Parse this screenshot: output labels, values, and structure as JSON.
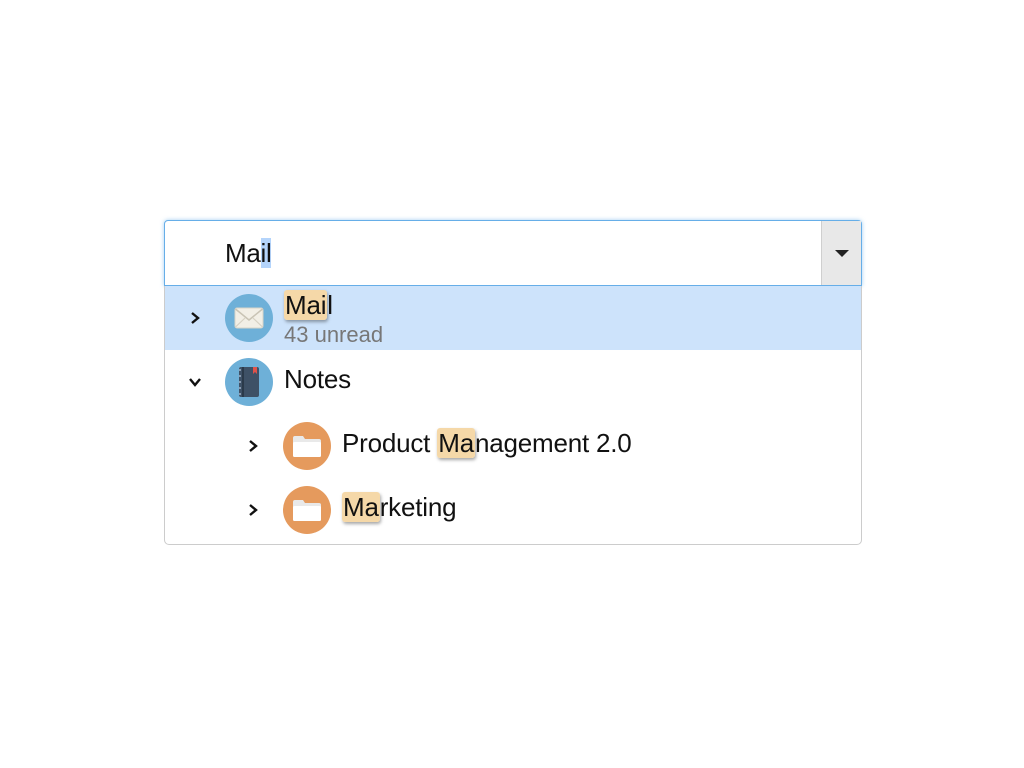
{
  "combobox": {
    "input_value_prefix": "Ma",
    "input_value_selected": "il",
    "dropdown_icon": "caret-down-icon"
  },
  "tree": {
    "items": [
      {
        "match": "Mai",
        "rest": "l",
        "secondary": "43 unread",
        "icon": "envelope-icon",
        "expanded": false,
        "selected": true,
        "level": 0
      },
      {
        "label": "Notes",
        "icon": "notebook-icon",
        "expanded": true,
        "selected": false,
        "level": 0
      },
      {
        "before": "Product ",
        "match": "Ma",
        "after": "nagement 2.0",
        "icon": "folder-icon",
        "expanded": false,
        "selected": false,
        "level": 1
      },
      {
        "match": "Ma",
        "after": "rketing",
        "icon": "folder-icon",
        "expanded": false,
        "selected": false,
        "level": 1
      }
    ]
  },
  "colors": {
    "selection": "#cde3fb",
    "highlight": "#f5d8a8",
    "focus_border": "#66aee8",
    "icon_blue": "#6eb0d8",
    "icon_orange": "#e59a5d"
  }
}
